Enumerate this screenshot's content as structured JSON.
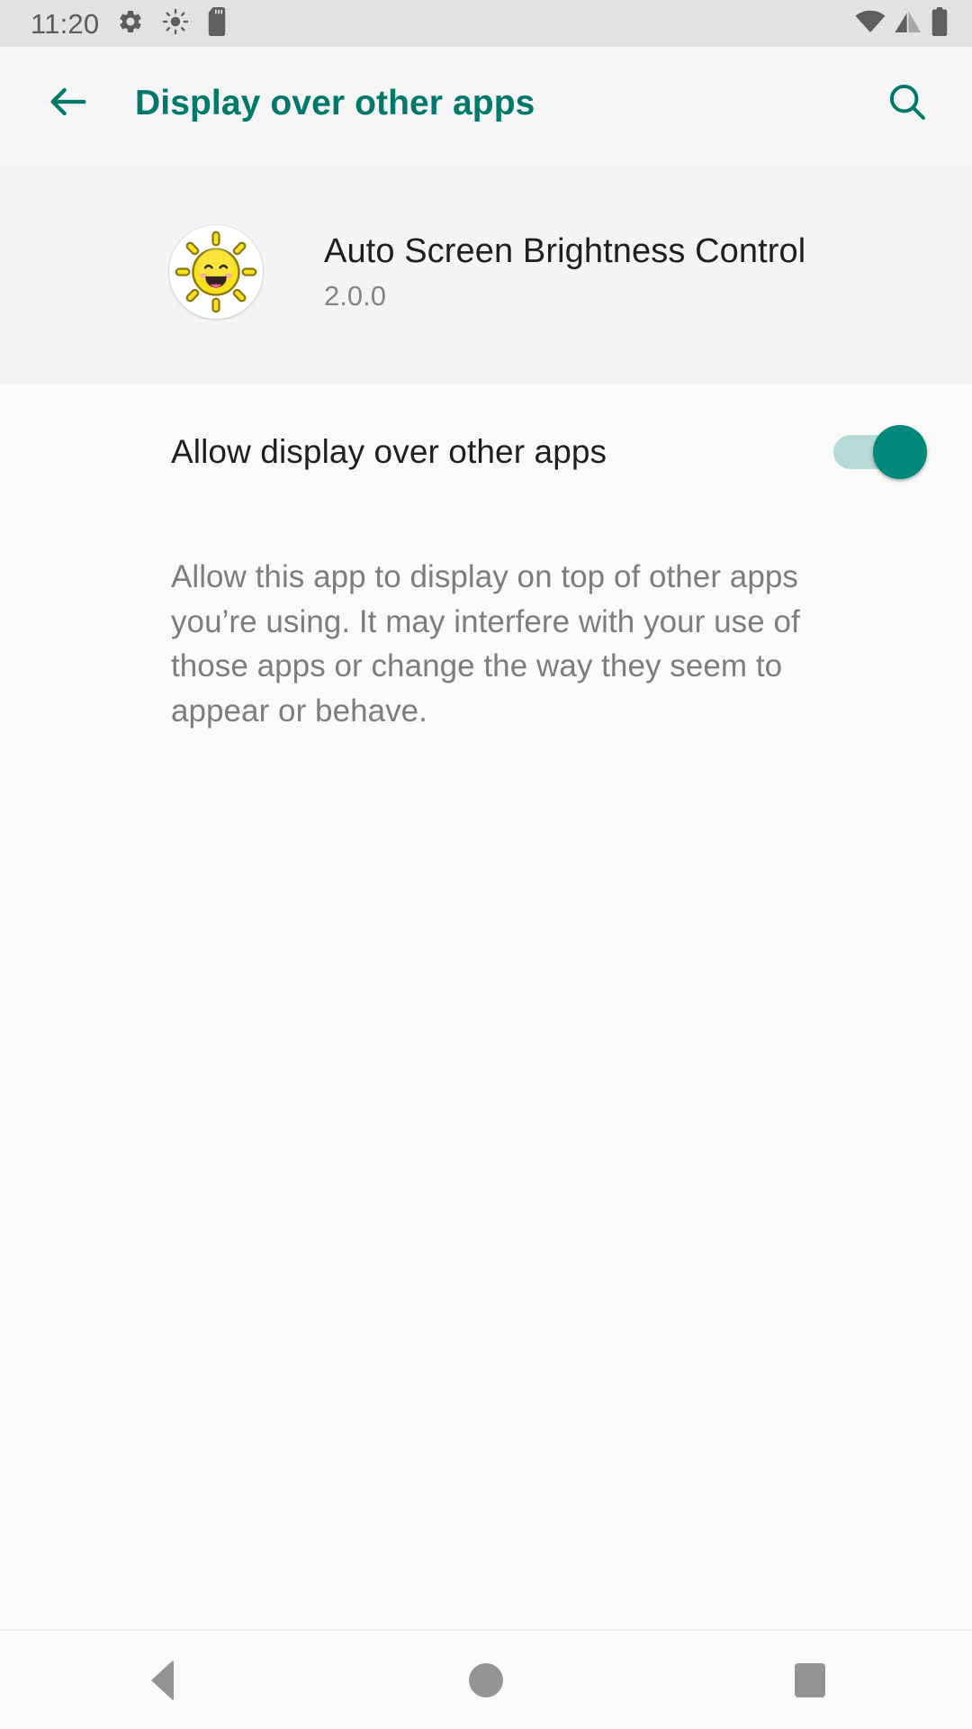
{
  "status_bar": {
    "clock": "11:20",
    "left_icons": [
      "gear-icon",
      "brightness-icon",
      "sd-card-icon"
    ],
    "right_icons": [
      "wifi-icon",
      "cellular-signal-icon",
      "battery-icon"
    ],
    "background_color": "#e2e2e2",
    "icon_color": "#5f5f5f"
  },
  "app_bar": {
    "back_icon": "arrow-back-icon",
    "title": "Display over other apps",
    "search_icon": "search-icon",
    "accent_color": "#00796b"
  },
  "app_header": {
    "icon": "sun-smiley-app-icon",
    "name": "Auto Screen Brightness Control",
    "version": "2.0.0"
  },
  "permission": {
    "toggle_label": "Allow display over other apps",
    "toggle_state": "on",
    "toggle_on_color": "#00897b",
    "toggle_track_color": "#b6dbd6",
    "description": "Allow this app to display on top of other apps you’re using. It may interfere with your use of those apps or change the way they seem to appear or behave."
  },
  "nav_bar": {
    "back": "nav-back-icon",
    "home": "nav-home-icon",
    "recents": "nav-recents-icon"
  }
}
